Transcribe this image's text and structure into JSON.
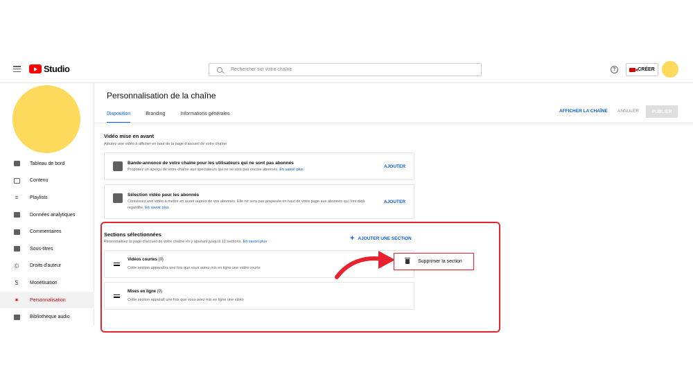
{
  "app": {
    "logo_text": "Studio"
  },
  "search": {
    "placeholder": "Rechercher sur votre chaîne"
  },
  "header": {
    "help_symbol": "?",
    "create_label": "CRÉER"
  },
  "sidebar": {
    "items": [
      {
        "label": "Tableau de bord",
        "icon": "dashboard-icon"
      },
      {
        "label": "Contenu",
        "icon": "video-icon"
      },
      {
        "label": "Playlists",
        "icon": "playlist-icon"
      },
      {
        "label": "Données analytiques",
        "icon": "analytics-icon"
      },
      {
        "label": "Commentaires",
        "icon": "comment-icon"
      },
      {
        "label": "Sous-titres",
        "icon": "subtitles-icon"
      },
      {
        "label": "Droits d'auteur",
        "icon": "copyright-icon"
      },
      {
        "label": "Monétisation",
        "icon": "dollar-icon"
      },
      {
        "label": "Personnalisation",
        "icon": "magic-wand-icon",
        "active": true
      },
      {
        "label": "Bibliothèque audio",
        "icon": "audio-library-icon"
      }
    ]
  },
  "page": {
    "title": "Personnalisation de la chaîne",
    "tabs": [
      "Disposition",
      "Branding",
      "Informations générales"
    ],
    "actions": {
      "view_channel": "AFFICHER LA CHAÎNE",
      "cancel": "ANNULER",
      "publish": "PUBLIER"
    }
  },
  "featured": {
    "title": "Vidéo mise en avant",
    "desc": "Ajoutez une vidéo à afficher en haut de la page d'accueil de votre chaîne",
    "cards": [
      {
        "title": "Bande-annonce de votre chaîne pour les utilisateurs qui ne sont pas abonnés",
        "desc": "Proposez un aperçu de votre chaîne aux spectateurs qui ne se sont pas encore abonnés.",
        "link": "En savoir plus",
        "button": "AJOUTER"
      },
      {
        "title": "Sélection vidéo pour les abonnés",
        "desc": "Choisissez une vidéo à mettre en avant auprès de vos abonnés. Elle ne sera pas proposée en haut de votre page aux abonnés qui l'ont déjà regardée.",
        "link": "En savoir plus",
        "button": "AJOUTER"
      }
    ]
  },
  "sections": {
    "title": "Sections sélectionnées",
    "desc": "Personnalisez la page d'accueil de votre chaîne en y ajoutant jusqu'à 12 sections.",
    "link": "En savoir plus",
    "add_label": "AJOUTER UNE SECTION",
    "add_symbol": "+",
    "items": [
      {
        "title": "Vidéos courtes",
        "count": "(0)",
        "desc": "Cette section apparaîtra une fois que vous aurez mis en ligne une vidéo courte"
      },
      {
        "title": "Mises en ligne",
        "count": "(0)",
        "desc": "Cette section apparaît une fois que vous avez mis en ligne une vidéo"
      }
    ]
  },
  "context_menu": {
    "delete_label": "Supprimer la section"
  },
  "colors": {
    "accent": "#065fd4",
    "brand_red": "#ff0000",
    "highlight": "#e8232f",
    "avatar": "#fdd95c"
  }
}
